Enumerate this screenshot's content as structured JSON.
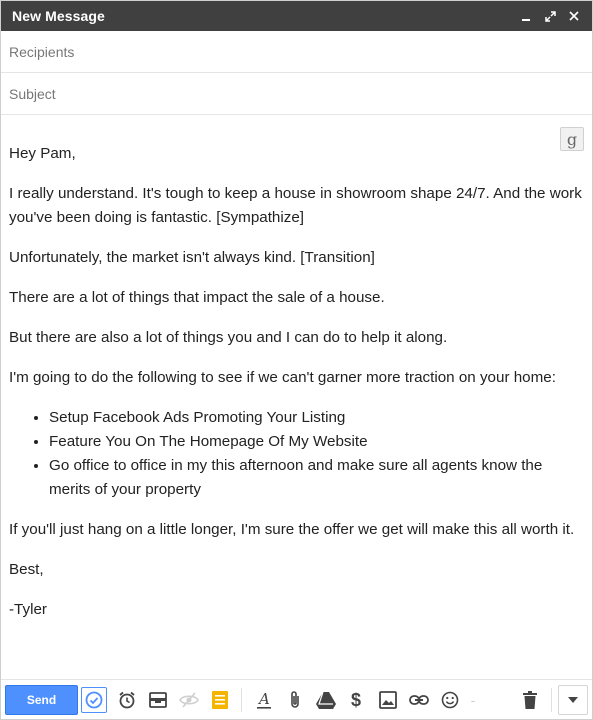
{
  "window": {
    "title": "New Message"
  },
  "fields": {
    "recipients_placeholder": "Recipients",
    "subject_placeholder": "Subject"
  },
  "grammarly": {
    "label": "g"
  },
  "message": {
    "greeting": "Hey Pam,",
    "p1": "I really understand. It's tough to keep a house in showroom shape 24/7. And the work you've been doing is fantastic. [Sympathize]",
    "p2": "Unfortunately, the market isn't always kind. [Transition]",
    "p3": "There are a lot of things that impact the sale of a house.",
    "p4": "But there are also a lot of things you and I can do to help it along.",
    "p5": "I'm going to do the following to see if we can't garner more traction on your home:",
    "bullets": [
      "Setup Facebook Ads Promoting Your Listing",
      "Feature You On The Homepage Of My Website",
      "Go office to office in my this afternoon and make sure all agents know the merits of your property"
    ],
    "p6": "If you'll just hang on a little longer, I'm sure the offer we get will make this all worth it.",
    "closing": "Best,",
    "signature": "-Tyler"
  },
  "toolbar": {
    "send_label": "Send",
    "divider_label": "-",
    "icons": [
      "boomerang-icon",
      "alarm-clock-icon",
      "template-icon",
      "hide-icon",
      "note-icon",
      "format-text-icon",
      "attach-icon",
      "drive-icon",
      "money-icon",
      "photo-icon",
      "link-icon",
      "emoji-icon",
      "trash-icon",
      "more-options-icon"
    ],
    "accent": "#4d90fe"
  }
}
